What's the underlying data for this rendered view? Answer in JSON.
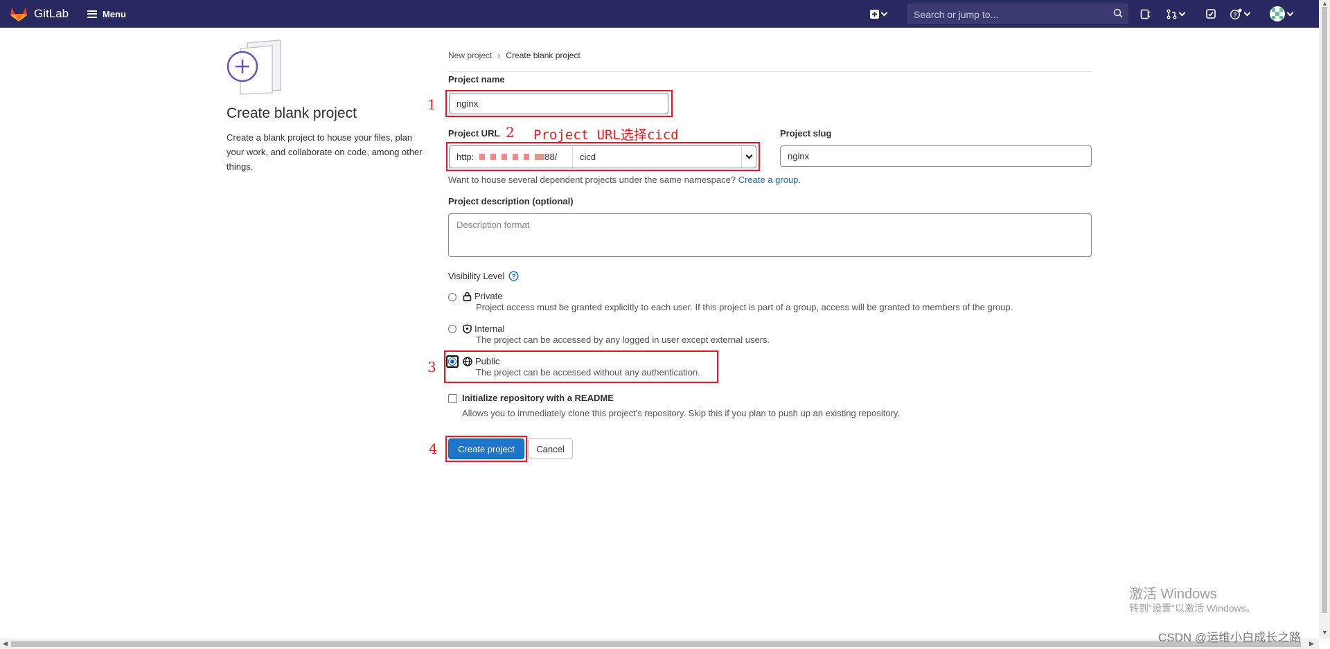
{
  "navbar": {
    "brand": "GitLab",
    "menu_label": "Menu",
    "search_placeholder": "Search or jump to...",
    "icons": [
      "gitlab-logo-icon",
      "hamburger-icon",
      "new-item-icon",
      "search-icon",
      "issues-icon",
      "merge-requests-icon",
      "todo-icon",
      "help-icon",
      "avatar"
    ],
    "bg_color": "#292961"
  },
  "left_panel": {
    "title": "Create blank project",
    "description": "Create a blank project to house your files, plan your work, and collaborate on code, among other things."
  },
  "breadcrumb": {
    "items": [
      "New project",
      "Create blank project"
    ]
  },
  "form": {
    "project_name_label": "Project name",
    "project_name_value": "nginx",
    "project_url_label": "Project URL",
    "url_prefix_start": "http:",
    "url_prefix_end": "88/",
    "url_namespace": "cicd",
    "project_slug_label": "Project slug",
    "project_slug_value": "nginx",
    "namespace_help": "Want to house several dependent projects under the same namespace?",
    "create_group_link": "Create a group.",
    "description_label": "Project description (optional)",
    "description_placeholder": "Description format",
    "visibility_label": "Visibility Level",
    "visibility_options": [
      {
        "title": "Private",
        "desc": "Project access must be granted explicitly to each user. If this project is part of a group, access will be granted to members of the group.",
        "selected": false,
        "icon": "lock-icon"
      },
      {
        "title": "Internal",
        "desc": "The project can be accessed by any logged in user except external users.",
        "selected": false,
        "icon": "shield-icon"
      },
      {
        "title": "Public",
        "desc": "The project can be accessed without any authentication.",
        "selected": true,
        "icon": "globe-icon"
      }
    ],
    "readme_label": "Initialize repository with a README",
    "readme_desc": "Allows you to immediately clone this project's repository. Skip this if you plan to push up an existing repository.",
    "readme_checked": false,
    "create_button": "Create project",
    "cancel_button": "Cancel",
    "accent_color": "#1f75cb"
  },
  "annotations": {
    "n1": "1",
    "n2": "2",
    "n2_text": "Project URL选择cicd",
    "n3": "3",
    "n4": "4",
    "color": "#e8191e"
  },
  "watermark": {
    "activate_title": "激活 Windows",
    "activate_sub": "转到\"设置\"以激活 Windows。",
    "csdn": "CSDN @运维小白成长之路"
  }
}
